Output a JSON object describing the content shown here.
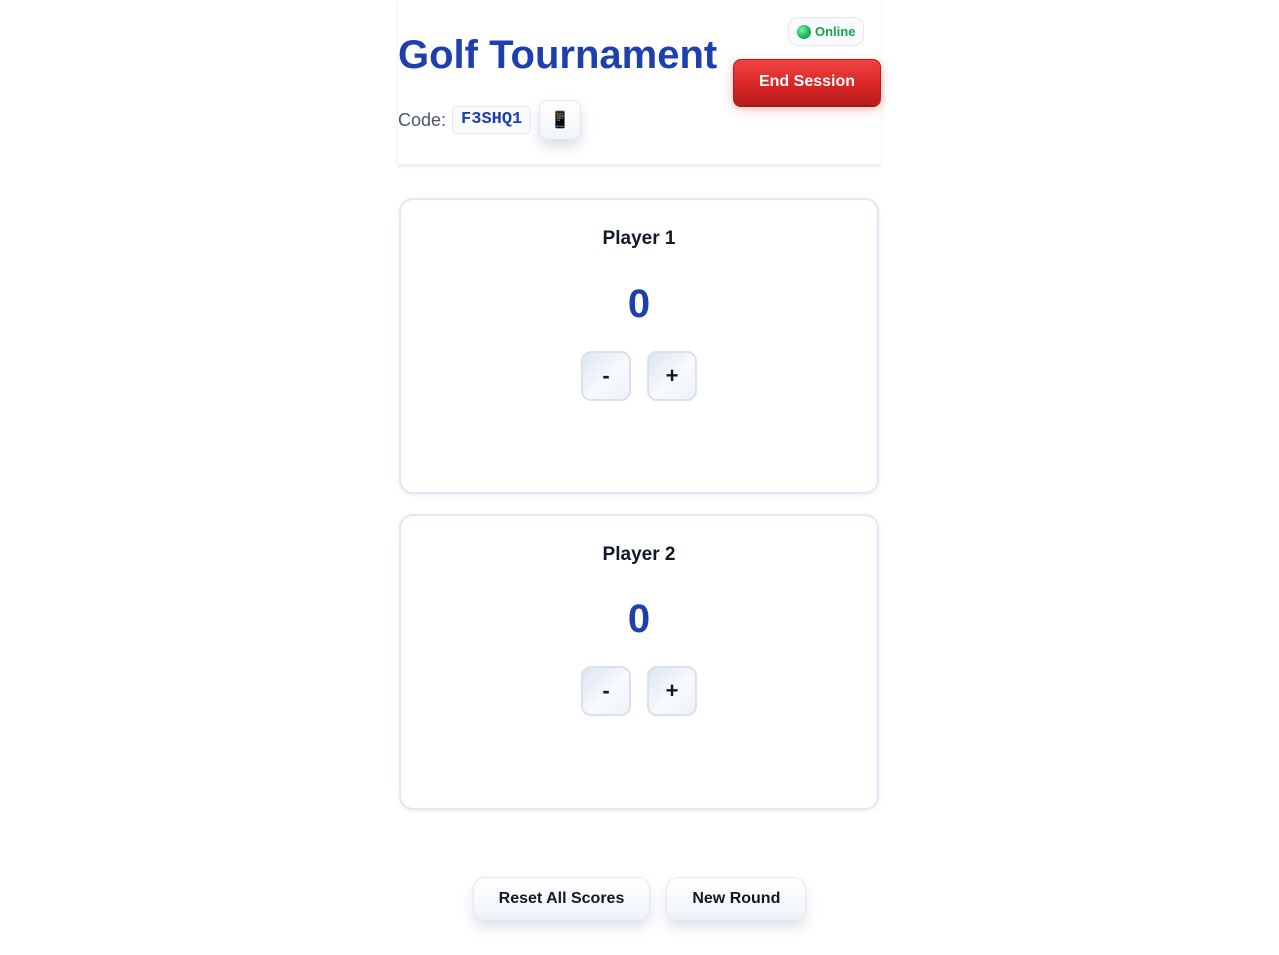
{
  "header": {
    "title": "Golf Tournament",
    "code_label": "Code:",
    "code_value": "F3SHQ1",
    "qr_icon": "📱",
    "qr_icon_name": "phone-icon",
    "status": {
      "label": "Online",
      "dot_color": "#22c55e",
      "text_color": "#16a34a"
    },
    "end_session_label": "End Session"
  },
  "players": [
    {
      "name": "Player 1",
      "score": "0",
      "decrement_label": "-",
      "increment_label": "+"
    },
    {
      "name": "Player 2",
      "score": "0",
      "decrement_label": "-",
      "increment_label": "+"
    }
  ],
  "footer": {
    "reset_label": "Reset All Scores",
    "new_round_label": "New Round"
  },
  "colors": {
    "accent": "#1e40af",
    "danger": "#dc2626",
    "online": "#16a34a"
  }
}
